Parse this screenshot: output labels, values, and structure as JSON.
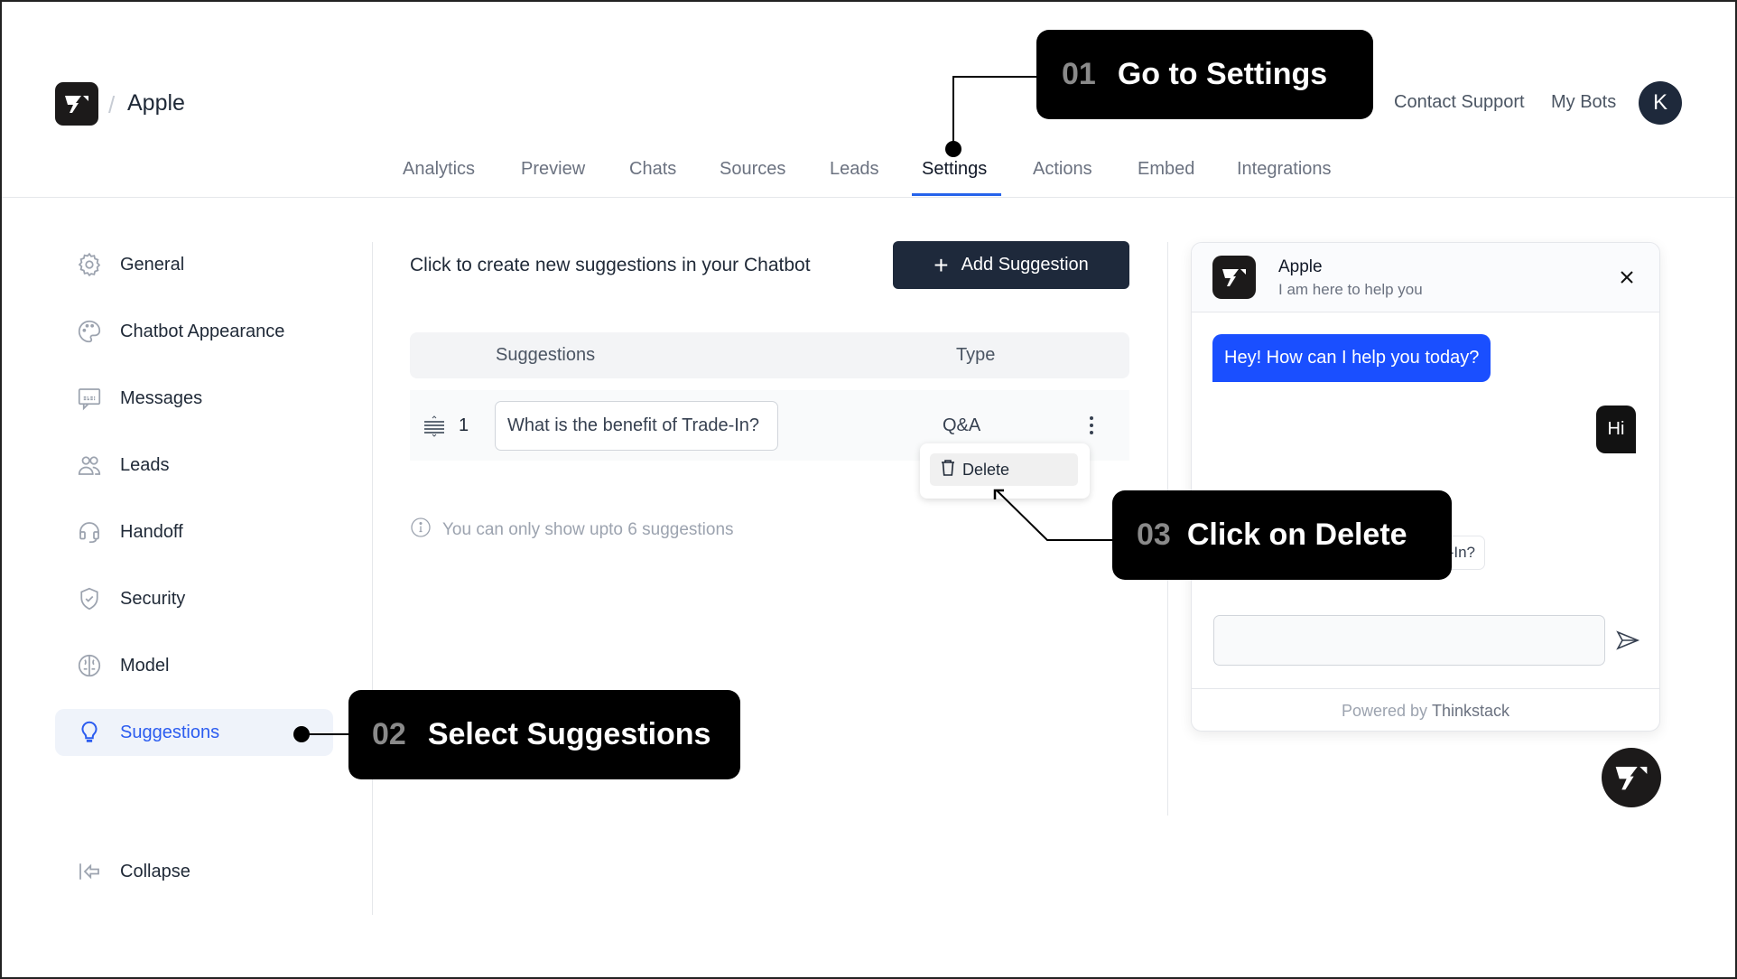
{
  "header": {
    "bot_name": "Apple",
    "breadcrumb_separator": "/",
    "contact_support": "Contact Support",
    "my_bots": "My Bots",
    "avatar_initial": "K",
    "tabs": [
      {
        "label": "Analytics",
        "active": false
      },
      {
        "label": "Preview",
        "active": false
      },
      {
        "label": "Chats",
        "active": false
      },
      {
        "label": "Sources",
        "active": false
      },
      {
        "label": "Leads",
        "active": false
      },
      {
        "label": "Settings",
        "active": true
      },
      {
        "label": "Actions",
        "active": false
      },
      {
        "label": "Embed",
        "active": false
      },
      {
        "label": "Integrations",
        "active": false
      }
    ]
  },
  "sidebar": {
    "items": [
      {
        "label": "General",
        "icon": "gear-icon"
      },
      {
        "label": "Chatbot Appearance",
        "icon": "palette-icon"
      },
      {
        "label": "Messages",
        "icon": "message-icon"
      },
      {
        "label": "Leads",
        "icon": "users-icon"
      },
      {
        "label": "Handoff",
        "icon": "headset-icon"
      },
      {
        "label": "Security",
        "icon": "shield-check-icon"
      },
      {
        "label": "Model",
        "icon": "brain-icon"
      },
      {
        "label": "Suggestions",
        "icon": "lightbulb-icon",
        "active": true
      }
    ],
    "collapse": "Collapse"
  },
  "main": {
    "intro": "Click to create new suggestions in your Chatbot",
    "add_button": "Add Suggestion",
    "table": {
      "headers": {
        "suggestions": "Suggestions",
        "type": "Type"
      },
      "rows": [
        {
          "index": "1",
          "suggestion": "What is the benefit of Trade-In?",
          "type": "Q&A"
        }
      ]
    },
    "row_menu": {
      "delete": "Delete"
    },
    "info": "You can only show upto 6 suggestions"
  },
  "chat_widget": {
    "title": "Apple",
    "subtitle": "I am here to help you",
    "bot_message": "Hey! How can I help you today?",
    "user_message": "Hi",
    "suggestion_chip": "What is the benefit of Trade-In?",
    "input_value": "",
    "footer_prefix": "Powered by",
    "footer_brand": "Thinkstack",
    "accent_color": "#1a4fff"
  },
  "annotations": [
    {
      "step": "01",
      "text": "Go to Settings"
    },
    {
      "step": "02",
      "text": "Select Suggestions"
    },
    {
      "step": "03",
      "text": "Click on Delete"
    }
  ]
}
